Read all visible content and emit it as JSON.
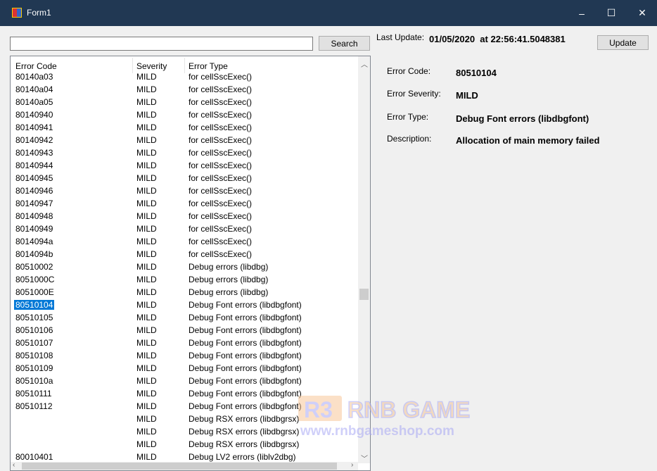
{
  "window": {
    "title": "Form1",
    "minimize": "–",
    "maximize": "☐",
    "close": "✕"
  },
  "search": {
    "value": "",
    "button": "Search"
  },
  "update": {
    "label": "Last Update:",
    "value": "01/05/2020  at 22:56:41.5048381",
    "button": "Update"
  },
  "list": {
    "columns": [
      "Error Code",
      "Severity",
      "Error Type"
    ],
    "selected": "80510104",
    "rows": [
      [
        "80140a03",
        "MILD",
        "for cellSscExec()"
      ],
      [
        "80140a04",
        "MILD",
        "for cellSscExec()"
      ],
      [
        "80140a05",
        "MILD",
        "for cellSscExec()"
      ],
      [
        "80140940",
        "MILD",
        "for cellSscExec()"
      ],
      [
        "80140941",
        "MILD",
        "for cellSscExec()"
      ],
      [
        "80140942",
        "MILD",
        "for cellSscExec()"
      ],
      [
        "80140943",
        "MILD",
        "for cellSscExec()"
      ],
      [
        "80140944",
        "MILD",
        "for cellSscExec()"
      ],
      [
        "80140945",
        "MILD",
        "for cellSscExec()"
      ],
      [
        "80140946",
        "MILD",
        "for cellSscExec()"
      ],
      [
        "80140947",
        "MILD",
        "for cellSscExec()"
      ],
      [
        "80140948",
        "MILD",
        "for cellSscExec()"
      ],
      [
        "80140949",
        "MILD",
        "for cellSscExec()"
      ],
      [
        "8014094a",
        "MILD",
        "for cellSscExec()"
      ],
      [
        "8014094b",
        "MILD",
        "for cellSscExec()"
      ],
      [
        "80510002",
        "MILD",
        "Debug errors (libdbg)"
      ],
      [
        "8051000C",
        "MILD",
        "Debug errors (libdbg)"
      ],
      [
        "8051000E",
        "MILD",
        "Debug errors (libdbg)"
      ],
      [
        "80510104",
        "MILD",
        "Debug Font errors (libdbgfont)"
      ],
      [
        "80510105",
        "MILD",
        "Debug Font errors (libdbgfont)"
      ],
      [
        "80510106",
        "MILD",
        "Debug Font errors (libdbgfont)"
      ],
      [
        "80510107",
        "MILD",
        "Debug Font errors (libdbgfont)"
      ],
      [
        "80510108",
        "MILD",
        "Debug Font errors (libdbgfont)"
      ],
      [
        "80510109",
        "MILD",
        "Debug Font errors (libdbgfont)"
      ],
      [
        "8051010a",
        "MILD",
        "Debug Font errors (libdbgfont)"
      ],
      [
        "80510111",
        "MILD",
        "Debug Font errors (libdbgfont)"
      ],
      [
        "80510112",
        "MILD",
        "Debug Font errors (libdbgfont)"
      ],
      [
        "",
        "MILD",
        "Debug RSX errors (libdbgrsx)"
      ],
      [
        "",
        "MILD",
        "Debug RSX errors (libdbgrsx)"
      ],
      [
        "",
        "MILD",
        "Debug RSX errors (libdbgrsx)"
      ],
      [
        "80010401",
        "MILD",
        "Debug LV2 errors (liblv2dbg)"
      ]
    ]
  },
  "details": [
    {
      "label": "Error Code:",
      "value": "80510104"
    },
    {
      "label": "Error Severity:",
      "value": "MILD"
    },
    {
      "label": "Error Type:",
      "value": "Debug Font errors (libdbgfont)"
    },
    {
      "label": "Description:",
      "value": "Allocation of main memory failed"
    }
  ],
  "watermark": {
    "logo": "R3",
    "brand": "RNB GAME",
    "url": "www.rnbgameshop.com"
  },
  "colors": {
    "titlebar": "#213853",
    "selection": "#0078d7"
  }
}
